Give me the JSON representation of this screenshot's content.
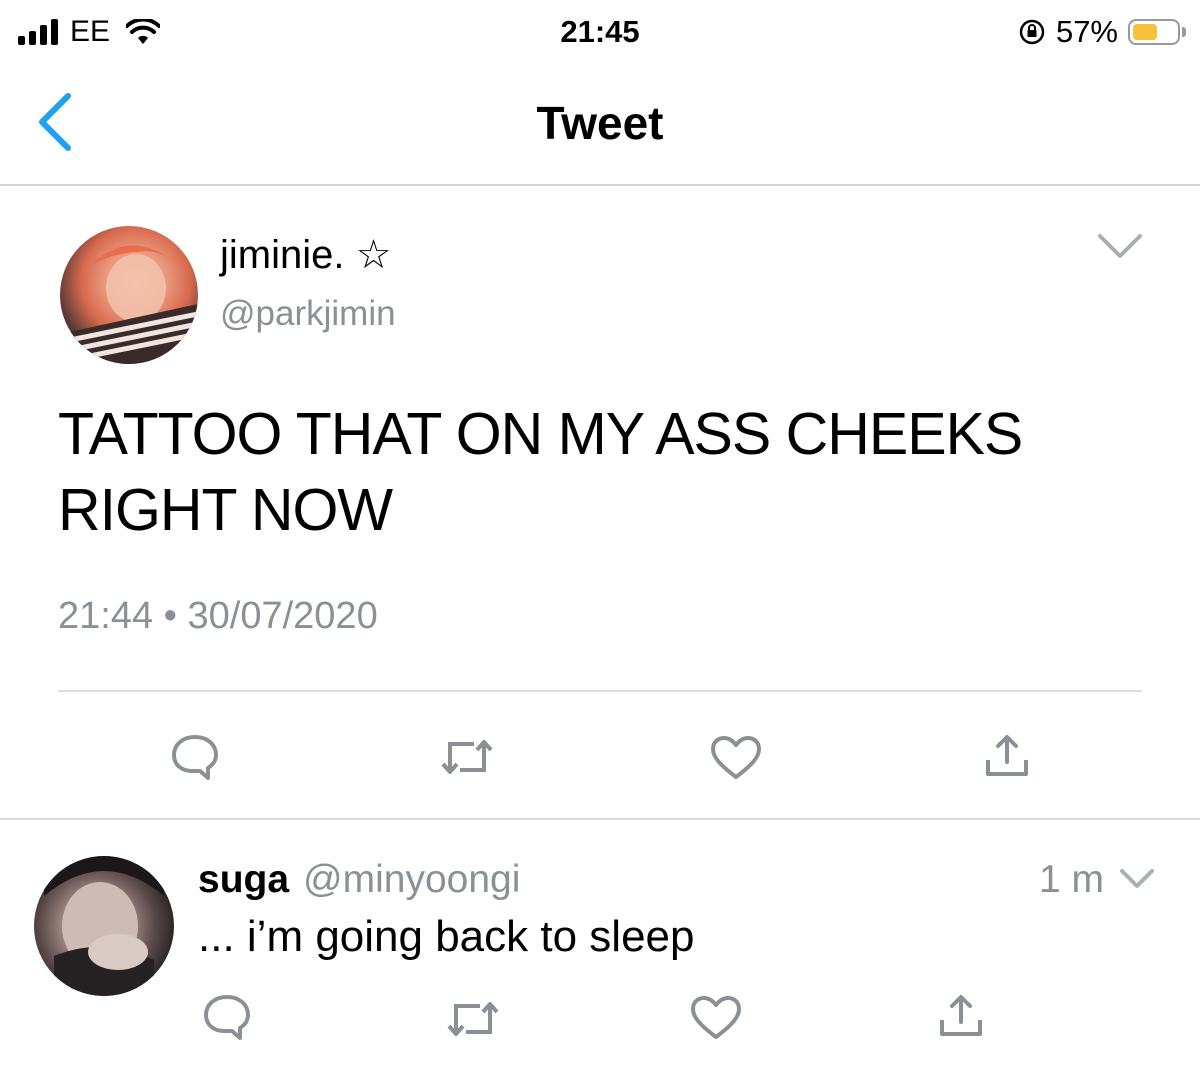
{
  "status_bar": {
    "carrier": "EE",
    "time": "21:45",
    "battery_percent": "57%",
    "battery_level": 0.57
  },
  "nav": {
    "title": "Tweet",
    "back_icon": "chevron-left-icon"
  },
  "tweet": {
    "display_name": "jiminie. ☆",
    "handle": "@parkjimin",
    "text": "TATTOO THAT ON MY ASS CHEEKS RIGHT NOW",
    "timestamp": "21:44 • 30/07/2020",
    "actions": [
      "reply-icon",
      "retweet-icon",
      "like-icon",
      "share-icon"
    ]
  },
  "reply": {
    "display_name": "suga",
    "handle": "@minyoongi",
    "time": "1 m",
    "text": "... i’m going back to sleep",
    "actions": [
      "reply-icon",
      "retweet-icon",
      "like-icon",
      "share-icon"
    ]
  },
  "colors": {
    "accent": "#1da1f2",
    "secondary_text": "#8a9196",
    "icon": "#8a9196",
    "battery": "#f5c33b"
  }
}
